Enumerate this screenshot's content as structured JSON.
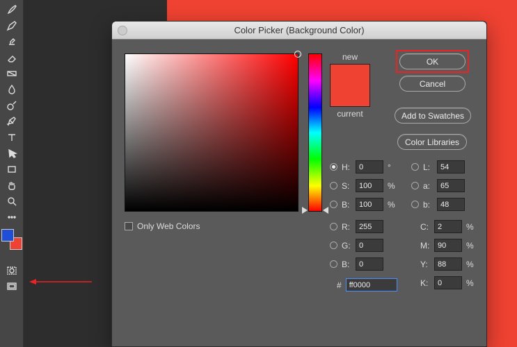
{
  "dialog": {
    "title": "Color Picker (Background Color)",
    "buttons": {
      "ok": "OK",
      "cancel": "Cancel",
      "add_swatches": "Add to Swatches",
      "color_libraries": "Color Libraries"
    },
    "new_label": "new",
    "current_label": "current",
    "only_web": "Only Web Colors",
    "fields": {
      "H": {
        "label": "H:",
        "value": "0",
        "unit": "°"
      },
      "S": {
        "label": "S:",
        "value": "100",
        "unit": "%"
      },
      "B": {
        "label": "B:",
        "value": "100",
        "unit": "%"
      },
      "R": {
        "label": "R:",
        "value": "255"
      },
      "G": {
        "label": "G:",
        "value": "0"
      },
      "Bb": {
        "label": "B:",
        "value": "0"
      },
      "L": {
        "label": "L:",
        "value": "54"
      },
      "a": {
        "label": "a:",
        "value": "65"
      },
      "bl": {
        "label": "b:",
        "value": "48"
      },
      "C": {
        "label": "C:",
        "value": "2",
        "unit": "%"
      },
      "M": {
        "label": "M:",
        "value": "90",
        "unit": "%"
      },
      "Y": {
        "label": "Y:",
        "value": "88",
        "unit": "%"
      },
      "K": {
        "label": "K:",
        "value": "0",
        "unit": "%"
      }
    },
    "hex": {
      "label": "#",
      "value": "ff0000"
    }
  },
  "colors": {
    "foreground": "#1f4ed8",
    "background": "#ef4232",
    "selected": "#ff0000"
  }
}
